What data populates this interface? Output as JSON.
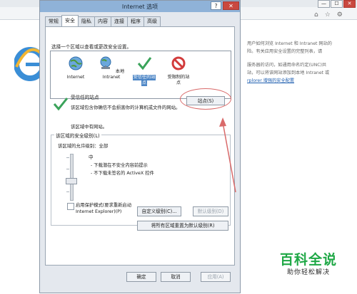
{
  "background_window": {
    "controls": [
      "—",
      "☐",
      "✕"
    ],
    "toolbar_icons": [
      "home-icon",
      "star-icon",
      "gear-icon"
    ],
    "text_lines": [
      "用户如何浏览 Internet 和 Intranet 网站的",
      "险。有关应用安全设置的完整列表，请",
      "",
      "服务器的访问，如通用命名约定(UNC)共",
      "站，可以将该网站添加到本地 Intranet 或",
      "rplorer 增强的安全配置"
    ]
  },
  "dialog": {
    "title": "Internet 选项",
    "help": "?",
    "close": "✕",
    "tabs": [
      "常规",
      "安全",
      "隐私",
      "内容",
      "连接",
      "程序",
      "高级"
    ],
    "active_tab": "安全",
    "zone_prompt": "选择一个区域以查看或更改安全设置。",
    "zones": [
      {
        "label_lines": [
          "Internet"
        ],
        "icon": "globe-icon",
        "selected": false
      },
      {
        "label_lines": [
          "本地",
          "Intranet"
        ],
        "icon": "intranet-icon",
        "selected": false
      },
      {
        "label_lines": [
          "受信任的站",
          "点"
        ],
        "icon": "trusted-check-icon",
        "selected": true
      },
      {
        "label_lines": [
          "受限制的站",
          "点"
        ],
        "icon": "restricted-icon",
        "selected": false
      }
    ],
    "zone_name": "受信任的站点",
    "sites_button": "站点(S)",
    "zone_desc": "该区域包含你确信不会损害你的计算机或文件的网站。",
    "zone_no_sites": "该区域中有网站。",
    "security_level_title": "该区域的安全级别(L)",
    "allowed_levels": "该区域的允许级别：全部",
    "level_name": "中",
    "level_items": [
      "- 下载潜在不安全内容前提示",
      "- 不下载未签名的 ActiveX 控件"
    ],
    "protected_mode_label": "启用保护模式(要求重新启动 Internet Explorer)(P)",
    "custom_level_button": "自定义级别(C)...",
    "default_level_button": "默认级别(D)",
    "reset_all_button": "将所有区域重置为默认级别(R)",
    "ok_button": "确定",
    "cancel_button": "取消",
    "apply_button": "应用(A)"
  },
  "watermark": {
    "title": "百科全说",
    "subtitle": "助你轻松解决"
  },
  "colors": {
    "title_bar": "#8fb2d8",
    "selection": "#4d86c6",
    "annotation": "#d96a6a",
    "watermark_green": "#1fa846"
  }
}
